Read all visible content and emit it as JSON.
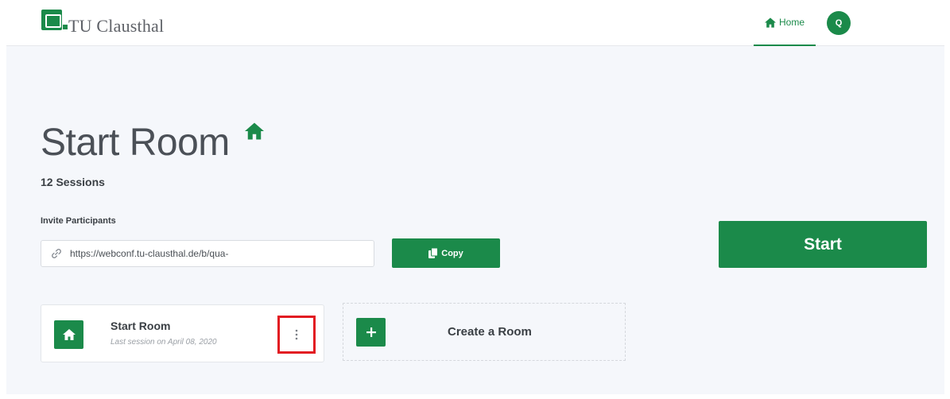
{
  "header": {
    "logo_text": "TU Clausthal",
    "nav_home_label": "Home",
    "avatar_initial": "Q"
  },
  "room": {
    "title": "Start Room",
    "sessions_text": "12 Sessions",
    "invite_label": "Invite Participants",
    "invite_url": "https://webconf.tu-clausthal.de/b/qua-",
    "copy_label": "Copy",
    "start_label": "Start"
  },
  "cards": {
    "room_name": "Start Room",
    "room_last_session": "Last session on April 08, 2020",
    "create_label": "Create a Room"
  },
  "colors": {
    "accent": "#1b8a4a",
    "highlight": "#e21b22",
    "background": "#f5f7fb"
  },
  "icons": {
    "logo": "university-logo-icon",
    "home": "home-icon",
    "link": "link-icon",
    "copy": "copy-icon",
    "menu": "kebab-menu-icon",
    "plus": "plus-icon"
  }
}
